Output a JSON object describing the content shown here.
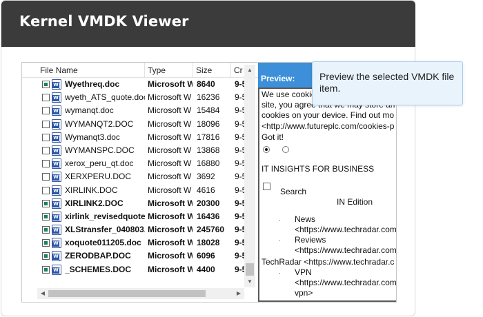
{
  "app": {
    "title": "Kernel VMDK Viewer"
  },
  "file_list": {
    "columns": [
      "File Name",
      "Type",
      "Size",
      "Cr"
    ],
    "rows": [
      {
        "checked": true,
        "bold": true,
        "name": "Wyethreq.doc",
        "type": "Microsoft W",
        "size": "8640",
        "created": "9-5"
      },
      {
        "checked": false,
        "bold": false,
        "name": "wyeth_ATS_quote.doc",
        "type": "Microsoft W",
        "size": "16236",
        "created": "9-5"
      },
      {
        "checked": false,
        "bold": false,
        "name": "wymanqt.doc",
        "type": "Microsoft W",
        "size": "15484",
        "created": "9-5"
      },
      {
        "checked": false,
        "bold": false,
        "name": "WYMANQT2.DOC",
        "type": "Microsoft W",
        "size": "18096",
        "created": "9-5"
      },
      {
        "checked": false,
        "bold": false,
        "name": "Wymanqt3.doc",
        "type": "Microsoft W",
        "size": "17816",
        "created": "9-5"
      },
      {
        "checked": false,
        "bold": false,
        "name": "WYMANSPC.DOC",
        "type": "Microsoft W",
        "size": "13868",
        "created": "9-5"
      },
      {
        "checked": false,
        "bold": false,
        "name": "xerox_peru_qt.doc",
        "type": "Microsoft W",
        "size": "16880",
        "created": "9-5"
      },
      {
        "checked": false,
        "bold": false,
        "name": "XERXPERU.DOC",
        "type": "Microsoft W",
        "size": "3692",
        "created": "9-5"
      },
      {
        "checked": false,
        "bold": false,
        "name": "XIRLINK.DOC",
        "type": "Microsoft W",
        "size": "4616",
        "created": "9-5"
      },
      {
        "checked": true,
        "bold": true,
        "name": "XIRLINK2.DOC",
        "type": "Microsoft W",
        "size": "20300",
        "created": "9-5"
      },
      {
        "checked": true,
        "bold": true,
        "name": "xirlink_revisedquote",
        "type": "Microsoft W",
        "size": "16436",
        "created": "9-5"
      },
      {
        "checked": true,
        "bold": true,
        "name": "XLStransfer_040803.c",
        "type": "Microsoft W",
        "size": "245760",
        "created": "9-5"
      },
      {
        "checked": true,
        "bold": true,
        "name": "xoquote011205.doc",
        "type": "Microsoft W",
        "size": "18028",
        "created": "9-5"
      },
      {
        "checked": true,
        "bold": true,
        "name": "ZERODBAP.DOC",
        "type": "Microsoft W",
        "size": "6096",
        "created": "9-5"
      },
      {
        "checked": true,
        "bold": true,
        "name": "_SCHEMES.DOC",
        "type": "Microsoft W",
        "size": "4400",
        "created": "9-5"
      }
    ]
  },
  "preview": {
    "label": "Preview:",
    "lines": [
      "We use cookies",
      "site, you agree that we may store an",
      "cookies on your device. Find out mo",
      "<http://www.futureplc.com/cookies-p",
      "Got it!",
      "IT INSIGHTS FOR BUSINESS",
      "Search",
      "IN Edition",
      "News",
      "<https://www.techradar.com",
      "Reviews",
      "<https://www.techradar.com",
      "TechRadar <https://www.techradar.c",
      "VPN",
      "<https://www.techradar.com",
      "vpn>"
    ],
    "bullet": "·"
  },
  "tooltip": {
    "text": "Preview the selected VMDK file item."
  },
  "colors": {
    "title_bar": "#3b3b3b",
    "preview_header": "#3c8fd8",
    "tooltip_bg": "#e8f3fc",
    "checkbox_mark": "#1a7f64"
  }
}
